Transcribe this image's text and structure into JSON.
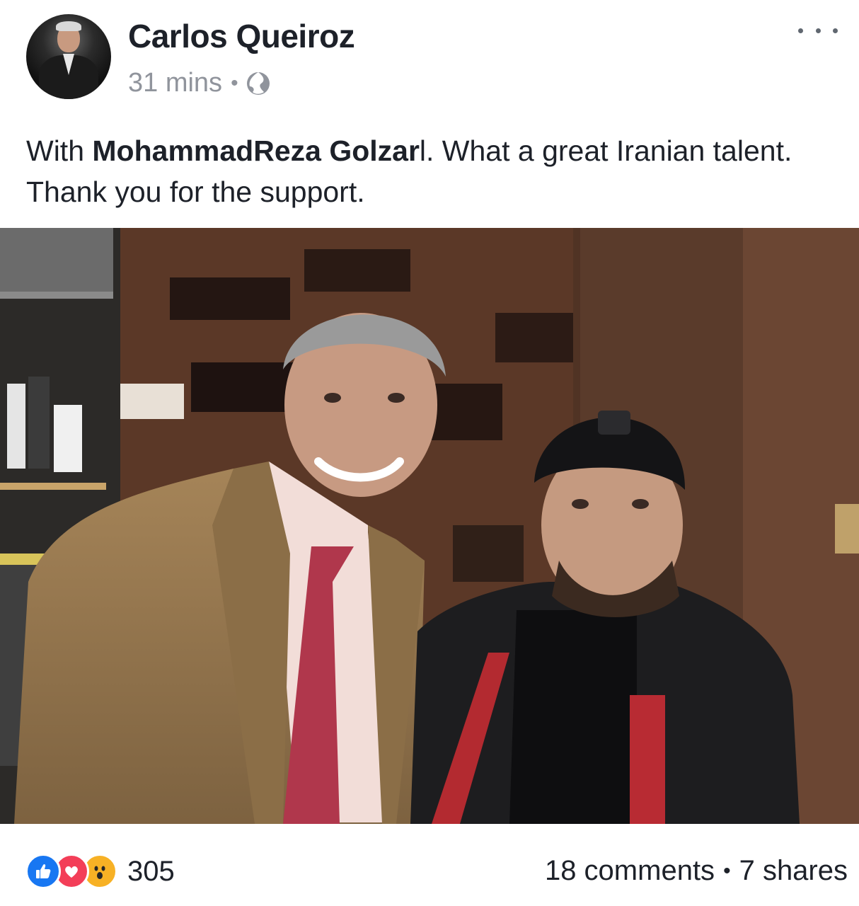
{
  "post": {
    "author": "Carlos Queiroz",
    "time": "31 mins",
    "separator": "•",
    "privacy_icon": "globe-icon",
    "menu_icon": "more-icon",
    "text_prefix": "With ",
    "mention": "MohammadReza Golzar",
    "text_suffix": "l. What a great Iranian talent. Thank you for the support."
  },
  "photo": {
    "subject": "photo"
  },
  "footer": {
    "reaction_icons": [
      "like-icon",
      "love-icon",
      "wow-icon"
    ],
    "reaction_count": "305",
    "comments": "18 comments",
    "separator": "•",
    "shares": "7 shares"
  },
  "colors": {
    "text": "#1d2129",
    "meta": "#90949c",
    "like": "#1877f2",
    "love": "#f33e58",
    "wow": "#f7b125"
  }
}
